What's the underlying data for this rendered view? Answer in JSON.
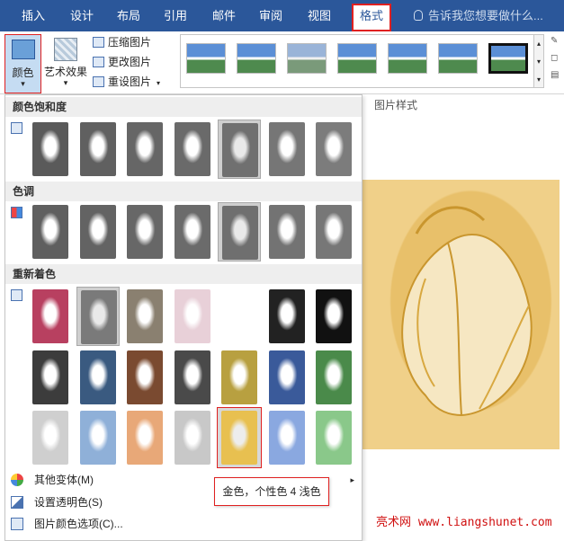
{
  "tabs": [
    "插入",
    "设计",
    "布局",
    "引用",
    "邮件",
    "审阅",
    "视图",
    "格式"
  ],
  "active_tab": "格式",
  "tell_me": "告诉我您想要做什么...",
  "ribbon": {
    "color_label": "颜色",
    "artistic_label": "艺术效果",
    "compress_label": "压缩图片",
    "change_label": "更改图片",
    "reset_label": "重设图片",
    "dropdown_glyph": "▾"
  },
  "picture_styles_label": "图片样式",
  "panel": {
    "saturation_header": "颜色饱和度",
    "tone_header": "色调",
    "recolor_header": "重新着色",
    "saturation_colors": [
      "#5a5a5a",
      "#606060",
      "#666666",
      "#6a6a6a",
      "#707070",
      "#767676",
      "#7c7c7c"
    ],
    "tone_colors": [
      "#5f5f5f",
      "#636363",
      "#676767",
      "#6b6b6b",
      "#6f6f6f",
      "#737373",
      "#777777"
    ],
    "recolor_row1": [
      "#b84060",
      "#7a7a7a",
      "#8a8070",
      "#e8d0d8",
      "#ffffff",
      "#222222",
      "#111111"
    ],
    "recolor_row2": [
      "#3c3c3c",
      "#3a5a80",
      "#7a4a30",
      "#4a4a4a",
      "#b8a040",
      "#3a5a9a",
      "#4a8a4a"
    ],
    "recolor_row3": [
      "#cfcfcf",
      "#8fb0d8",
      "#e8a878",
      "#c8c8c8",
      "#e8c050",
      "#8aa8e0",
      "#8ac88a"
    ],
    "more_variants": "其他变体(M)",
    "set_transparent": "设置透明色(S)",
    "color_options": "图片颜色选项(C)...",
    "submenu_glyph": "▸"
  },
  "tooltip": "金色，个性色 4 浅色",
  "watermark": "亮术网 www.liangshunet.com"
}
